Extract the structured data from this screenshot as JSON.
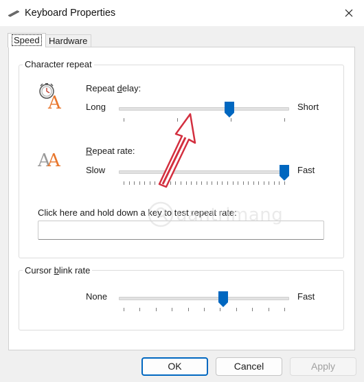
{
  "window": {
    "title": "Keyboard Properties",
    "icon": "keyboard-icon",
    "close_glyph": "✕"
  },
  "tabs": [
    {
      "label": "Speed",
      "selected": true
    },
    {
      "label": "Hardware",
      "selected": false
    }
  ],
  "character_repeat": {
    "group_label": "Character repeat",
    "repeat_delay": {
      "label_prefix": "Repeat ",
      "label_accel": "d",
      "label_suffix": "elay:",
      "min_label": "Long",
      "max_label": "Short",
      "position_fraction": 0.66,
      "tick_count": 4
    },
    "repeat_rate": {
      "label_accel": "R",
      "label_suffix": "epeat rate:",
      "min_label": "Slow",
      "max_label": "Fast",
      "position_fraction": 1.0,
      "tick_count": 32
    },
    "test_label": "Click here and hold down a key to test repeat rate:",
    "test_value": ""
  },
  "cursor_blink": {
    "group_label_prefix": "Cursor ",
    "group_label_accel": "b",
    "group_label_suffix": "link rate",
    "min_label": "None",
    "max_label": "Fast",
    "position_fraction": 0.62,
    "tick_count": 11
  },
  "buttons": {
    "ok": "OK",
    "cancel": "Cancel",
    "apply": "Apply"
  },
  "colors": {
    "accent": "#0067c0",
    "icon_orange": "#e8772e",
    "annotation_arrow": "#d32f3f"
  },
  "watermark_text": "uantrimang"
}
